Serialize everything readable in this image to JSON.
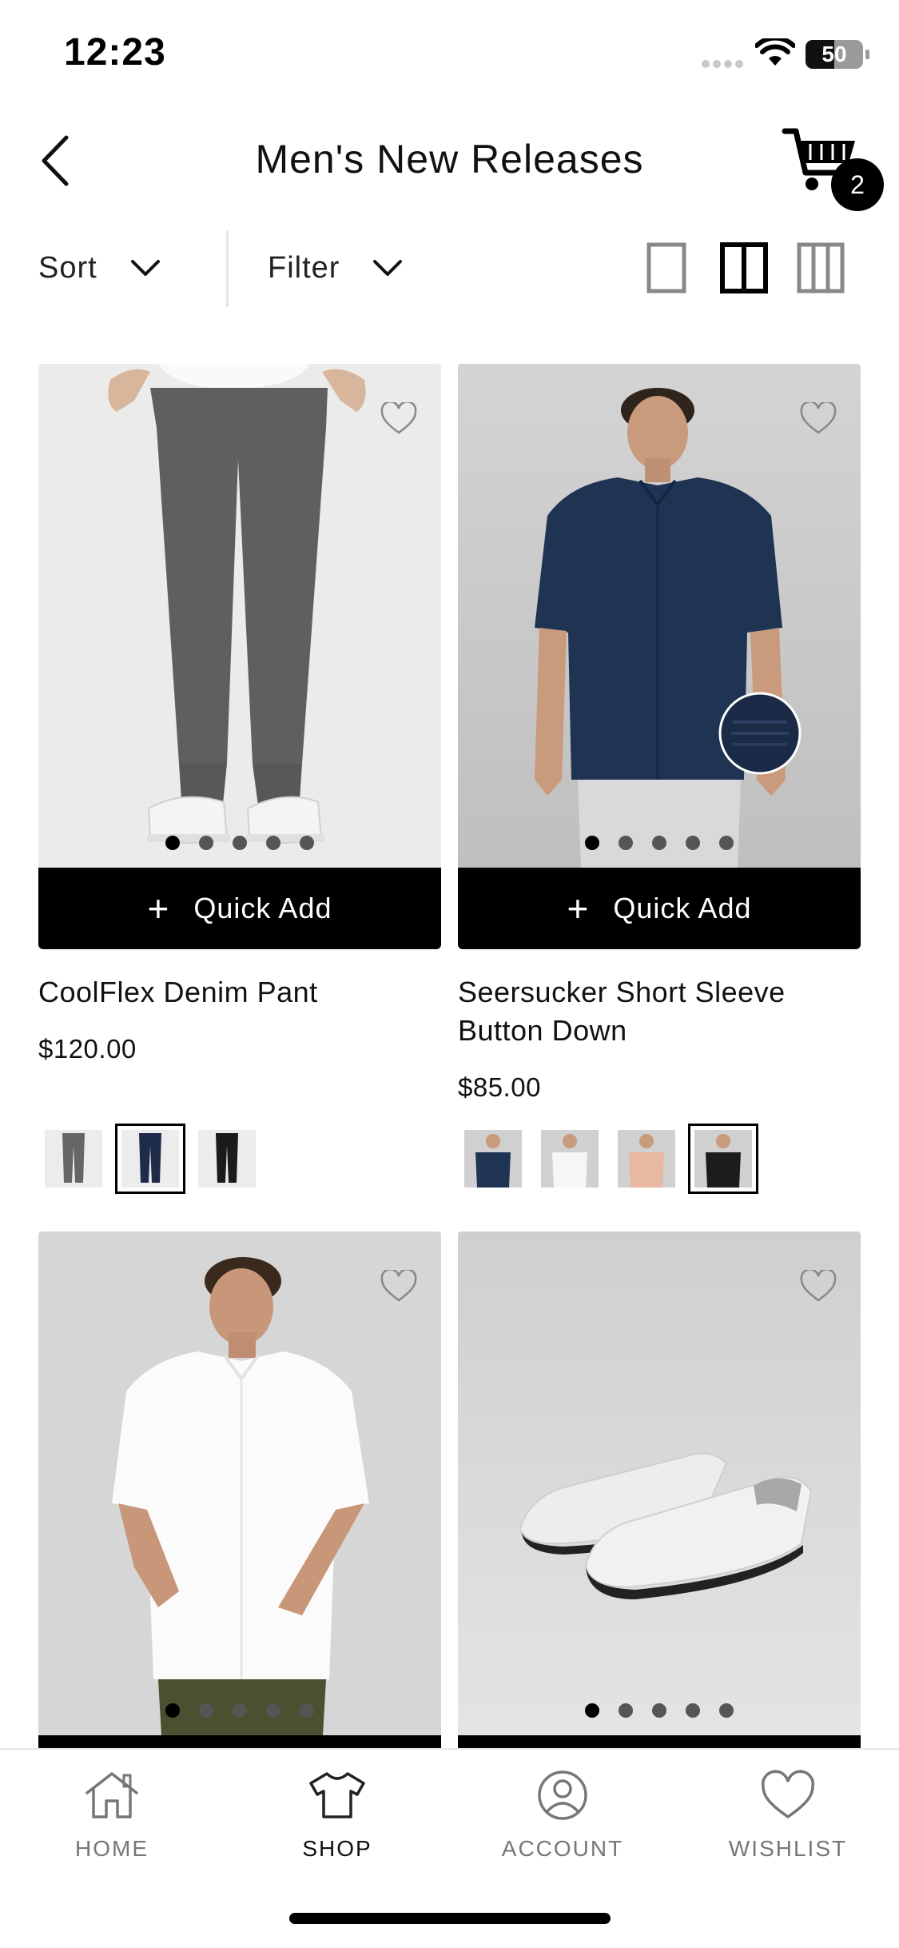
{
  "status_bar": {
    "time": "12:23",
    "battery": "50"
  },
  "header": {
    "title": "Men's New Releases",
    "cart_count": "2"
  },
  "toolbar": {
    "sort_label": "Sort",
    "filter_label": "Filter"
  },
  "products": [
    {
      "name": "CoolFlex Denim Pant",
      "price": "$120.00",
      "quick_add": "Quick Add"
    },
    {
      "name": "Seersucker Short Sleeve Button Down",
      "price": "$85.00",
      "quick_add": "Quick Add"
    },
    {
      "name": "",
      "price": "",
      "quick_add": ""
    },
    {
      "name": "",
      "price": "",
      "quick_add": ""
    }
  ],
  "nav": {
    "items": [
      {
        "label": "HOME",
        "icon": "home-icon"
      },
      {
        "label": "SHOP",
        "icon": "shirt-icon"
      },
      {
        "label": "ACCOUNT",
        "icon": "account-icon"
      },
      {
        "label": "WISHLIST",
        "icon": "heart-icon"
      }
    ]
  },
  "colors": {
    "accent": "#000000",
    "inactive_nav": "#777777"
  }
}
